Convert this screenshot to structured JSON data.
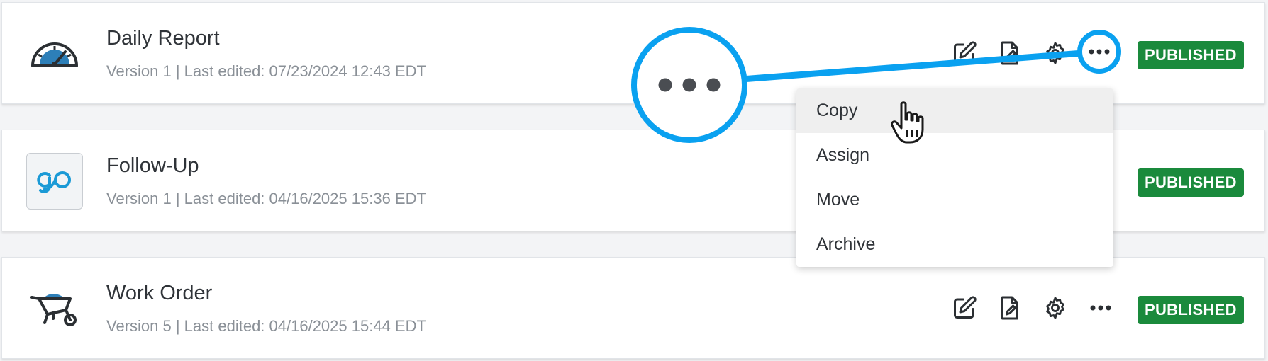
{
  "forms": [
    {
      "title": "Daily Report",
      "meta": "Version 1 | Last edited: 07/23/2024 12:43 EDT",
      "status": "PUBLISHED",
      "icon": "speedometer-icon"
    },
    {
      "title": "Follow-Up",
      "meta": "Version 1 | Last edited: 04/16/2025 15:36 EDT",
      "status": "PUBLISHED",
      "icon": "go-logo-icon"
    },
    {
      "title": "Work Order",
      "meta": "Version 5 | Last edited: 04/16/2025 15:44 EDT",
      "status": "PUBLISHED",
      "icon": "wheelbarrow-icon"
    }
  ],
  "actions": [
    "edit-icon",
    "document-edit-icon",
    "gear-icon",
    "more-icon"
  ],
  "menu": {
    "items": [
      "Copy",
      "Assign",
      "Move",
      "Archive"
    ],
    "hovered": "Copy"
  },
  "colors": {
    "published": "#1a8a3c",
    "highlight": "#0aa1f0",
    "title_text": "#2f3338",
    "meta_text": "#8a9097"
  }
}
